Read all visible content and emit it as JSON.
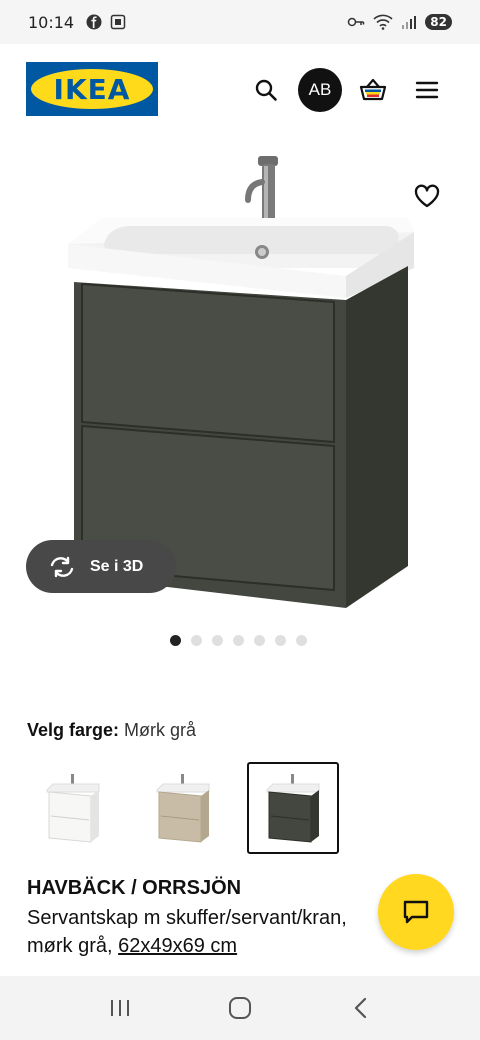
{
  "status": {
    "time": "10:14",
    "battery": "82"
  },
  "brand": {
    "logo_text": "IKEA",
    "blue": "#0058a3",
    "yellow": "#ffda1a"
  },
  "header": {
    "avatar_initials": "AB",
    "icons": [
      "search-icon",
      "basket-icon",
      "menu-icon"
    ]
  },
  "gallery": {
    "see_3d_label": "Se i 3D",
    "dot_count": 7,
    "active_dot": 1
  },
  "color_picker": {
    "label": "Velg farge:",
    "selected_value": "Mørk grå",
    "options": [
      "Hvit",
      "Beige",
      "Mørk grå"
    ]
  },
  "product": {
    "name": "HAVBÄCK / ORRSJÖN",
    "description": "Servantskap m skuffer/servant/kran, mørk grå,",
    "size": "62x49x69 cm"
  },
  "colors": {
    "cabinet": "#444740",
    "chat_button": "#ffd81f"
  }
}
